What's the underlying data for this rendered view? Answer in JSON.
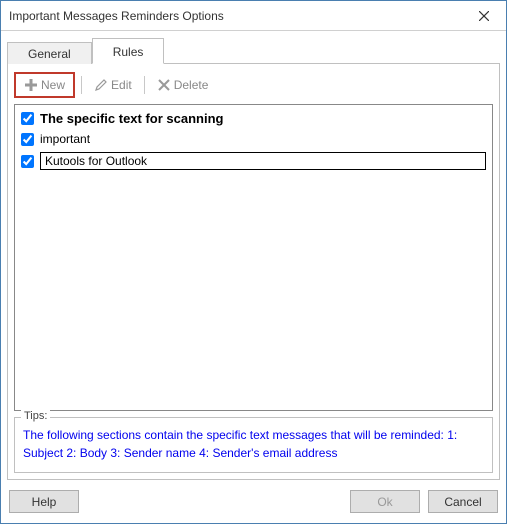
{
  "window": {
    "title": "Important Messages Reminders Options"
  },
  "tabs": {
    "general": "General",
    "rules": "Rules",
    "active": "rules"
  },
  "toolbar": {
    "new_label": "New",
    "edit_label": "Edit",
    "delete_label": "Delete"
  },
  "rules_list": {
    "header": "The specific text for scanning",
    "items": [
      {
        "label": "important",
        "checked": true,
        "boxed": false
      },
      {
        "label": "Kutools for Outlook",
        "checked": true,
        "boxed": true
      }
    ]
  },
  "tips": {
    "legend": "Tips:",
    "text": "The following sections contain the specific text messages that will be reminded: 1: Subject 2: Body 3: Sender name 4: Sender's email address"
  },
  "footer": {
    "help": "Help",
    "ok": "Ok",
    "cancel": "Cancel"
  }
}
